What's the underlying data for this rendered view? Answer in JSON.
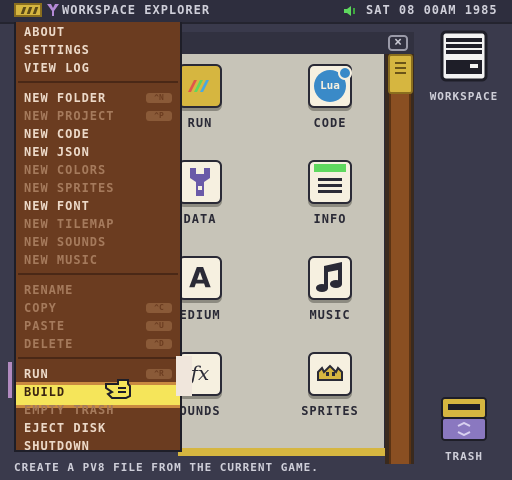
{
  "topbar": {
    "title": "WORKSPACE EXPLORER",
    "datetime": "SAT 08 00AM 1985"
  },
  "menu": {
    "groups": [
      [
        {
          "label": "ABOUT",
          "enabled": true,
          "shortcut": ""
        },
        {
          "label": "SETTINGS",
          "enabled": true,
          "shortcut": ""
        },
        {
          "label": "VIEW LOG",
          "enabled": true,
          "shortcut": ""
        }
      ],
      [
        {
          "label": "NEW FOLDER",
          "enabled": true,
          "shortcut": "^N"
        },
        {
          "label": "NEW PROJECT",
          "enabled": false,
          "shortcut": "^P"
        },
        {
          "label": "NEW CODE",
          "enabled": true,
          "shortcut": ""
        },
        {
          "label": "NEW JSON",
          "enabled": true,
          "shortcut": ""
        },
        {
          "label": "NEW COLORS",
          "enabled": false,
          "shortcut": ""
        },
        {
          "label": "NEW SPRITES",
          "enabled": false,
          "shortcut": ""
        },
        {
          "label": "NEW FONT",
          "enabled": true,
          "shortcut": ""
        },
        {
          "label": "NEW TILEMAP",
          "enabled": false,
          "shortcut": ""
        },
        {
          "label": "NEW SOUNDS",
          "enabled": false,
          "shortcut": ""
        },
        {
          "label": "NEW MUSIC",
          "enabled": false,
          "shortcut": ""
        }
      ],
      [
        {
          "label": "RENAME",
          "enabled": false,
          "shortcut": ""
        },
        {
          "label": "COPY",
          "enabled": false,
          "shortcut": "^C"
        },
        {
          "label": "PASTE",
          "enabled": false,
          "shortcut": "^U"
        },
        {
          "label": "DELETE",
          "enabled": false,
          "shortcut": "^D"
        }
      ],
      [
        {
          "label": "RUN",
          "enabled": true,
          "shortcut": "^R"
        },
        {
          "label": "BUILD",
          "enabled": true,
          "shortcut": "",
          "highlighted": true
        },
        {
          "label": "EMPTY TRASH",
          "enabled": false,
          "shortcut": ""
        },
        {
          "label": "EJECT DISK",
          "enabled": true,
          "shortcut": ""
        },
        {
          "label": "SHUTDOWN",
          "enabled": true,
          "shortcut": ""
        }
      ]
    ]
  },
  "explorer": {
    "files": [
      {
        "label": "RUN",
        "icon": "run-icon"
      },
      {
        "label": "CODE",
        "icon": "lua-code-icon",
        "icon_text": "Lua"
      },
      {
        "label": "DATA",
        "icon": "wrench-data-icon"
      },
      {
        "label": "INFO",
        "icon": "info-doc-icon"
      },
      {
        "label": "EDIUM",
        "icon": "font-a-icon",
        "icon_text": "A"
      },
      {
        "label": "MUSIC",
        "icon": "music-note-icon"
      },
      {
        "label": "OUNDS",
        "icon": "sound-fx-icon",
        "icon_text": "fx"
      },
      {
        "label": "SPRITES",
        "icon": "sprites-icon"
      }
    ]
  },
  "desktop": {
    "workspace_label": "WORKSPACE",
    "trash_label": "TRASH"
  },
  "status_bar": {
    "text": "CREATE A PV8 FILE FROM THE CURRENT GAME."
  },
  "colors": {
    "accent": "#d6b640",
    "menu_bg": "#6b3c20",
    "highlight": "#f5e55a",
    "window_body": "#c7c4b8"
  }
}
